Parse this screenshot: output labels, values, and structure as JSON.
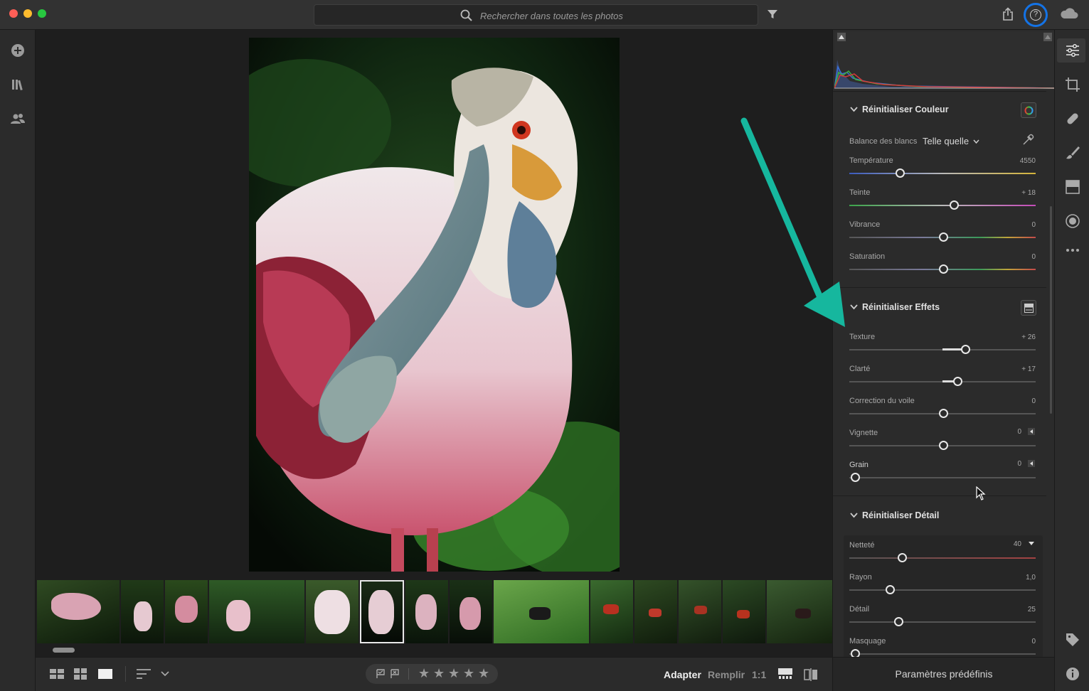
{
  "search": {
    "placeholder": "Rechercher dans toutes les photos"
  },
  "colors": {
    "accent": "#1473e6",
    "arrow": "#16b79e"
  },
  "panel": {
    "color": {
      "title": "Réinitialiser Couleur",
      "wb_label": "Balance des blancs",
      "wb_value": "Telle quelle",
      "sliders": [
        {
          "label": "Température",
          "value": "4550"
        },
        {
          "label": "Teinte",
          "value": "+ 18"
        },
        {
          "label": "Vibrance",
          "value": "0"
        },
        {
          "label": "Saturation",
          "value": "0"
        }
      ]
    },
    "effects": {
      "title": "Réinitialiser Effets",
      "sliders": [
        {
          "label": "Texture",
          "value": "+ 26"
        },
        {
          "label": "Clarté",
          "value": "+ 17"
        },
        {
          "label": "Correction du voile",
          "value": "0"
        },
        {
          "label": "Vignette",
          "value": "0"
        },
        {
          "label": "Grain",
          "value": "0"
        }
      ]
    },
    "detail": {
      "title": "Réinitialiser Détail",
      "sliders": [
        {
          "label": "Netteté",
          "value": "40"
        },
        {
          "label": "Rayon",
          "value": "1,0"
        },
        {
          "label": "Détail",
          "value": "25"
        },
        {
          "label": "Masquage",
          "value": "0"
        }
      ]
    },
    "presets_label": "Paramètres prédéfinis"
  },
  "bottombar": {
    "fit": "Adapter",
    "fill": "Remplir",
    "one_to_one": "1:1",
    "stars": [
      "★",
      "★",
      "★",
      "★",
      "★"
    ]
  }
}
